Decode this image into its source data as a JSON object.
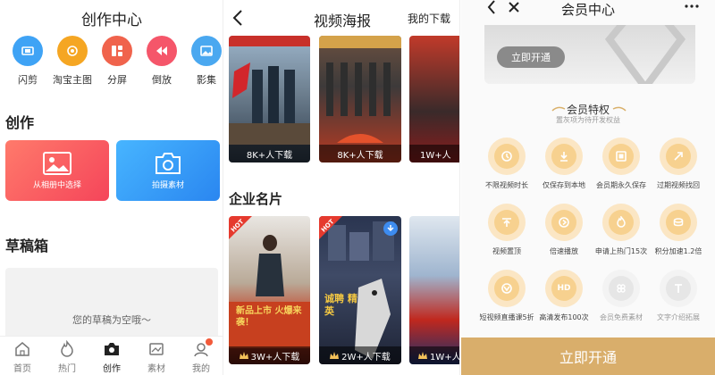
{
  "creation": {
    "title": "创作中心",
    "tools": [
      {
        "label": "闪剪",
        "icon": "clip-icon",
        "color": "#3fa3f5"
      },
      {
        "label": "淘宝主图",
        "icon": "taobao-icon",
        "color": "#f5a623"
      },
      {
        "label": "分屏",
        "icon": "split-screen-icon",
        "color": "#f0634c"
      },
      {
        "label": "倒放",
        "icon": "rewind-icon",
        "color": "#f5566a"
      },
      {
        "label": "影集",
        "icon": "album-icon",
        "color": "#4aa8f0"
      }
    ],
    "section_create": "创作",
    "card_album": "从相册中选择",
    "card_camera": "拍摄素材",
    "section_draft": "草稿箱",
    "draft_empty": "您的草稿为空哦～",
    "tabs": [
      {
        "label": "首页",
        "icon": "home-icon"
      },
      {
        "label": "热门",
        "icon": "fire-icon"
      },
      {
        "label": "创作",
        "icon": "camera-icon"
      },
      {
        "label": "素材",
        "icon": "material-icon"
      },
      {
        "label": "我的",
        "icon": "profile-icon"
      }
    ]
  },
  "poster": {
    "title": "视频海报",
    "right_link": "我的下载",
    "row1": [
      {
        "downloads": "8K+人下载"
      },
      {
        "downloads": "8K+人下载"
      },
      {
        "downloads": "1W+人"
      }
    ],
    "section": "企业名片",
    "row2": [
      {
        "downloads": "3W+人下载",
        "hot": "HOT",
        "overlay": "新品上市 火爆来袭！"
      },
      {
        "downloads": "2W+人下载",
        "hot": "HOT",
        "overlay": "诚聘 精英"
      },
      {
        "downloads": "1W+人",
        "hot": "",
        "overlay": ""
      }
    ]
  },
  "member": {
    "title": "会员中心",
    "banner_button": "立即开通",
    "privilege_title": "会员特权",
    "privilege_sub": "置灰项为待开发权益",
    "perks": [
      {
        "label": "不限视频时长",
        "icon": "clock-icon",
        "dim": false
      },
      {
        "label": "仅保存到本地",
        "icon": "download-icon",
        "dim": false
      },
      {
        "label": "会员期永久保存",
        "icon": "save-icon",
        "dim": false
      },
      {
        "label": "过期视频找回",
        "icon": "restore-icon",
        "dim": false
      },
      {
        "label": "视频置顶",
        "icon": "pin-top-icon",
        "dim": false
      },
      {
        "label": "倍速播放",
        "icon": "speed-play-icon",
        "dim": false
      },
      {
        "label": "申请上热门15次",
        "icon": "hot-apply-icon",
        "dim": false
      },
      {
        "label": "积分加速1.2倍",
        "icon": "points-icon",
        "dim": false
      },
      {
        "label": "短视频直播课5折",
        "icon": "live-course-icon",
        "dim": false
      },
      {
        "label": "高清发布100次",
        "icon": "hd-icon",
        "dim": false
      },
      {
        "label": "会员免费素材",
        "icon": "free-material-icon",
        "dim": true
      },
      {
        "label": "文字介绍拓展",
        "icon": "text-expand-icon",
        "dim": true
      }
    ],
    "open_button": "立即开通",
    "accent": "#d9ae6b"
  }
}
